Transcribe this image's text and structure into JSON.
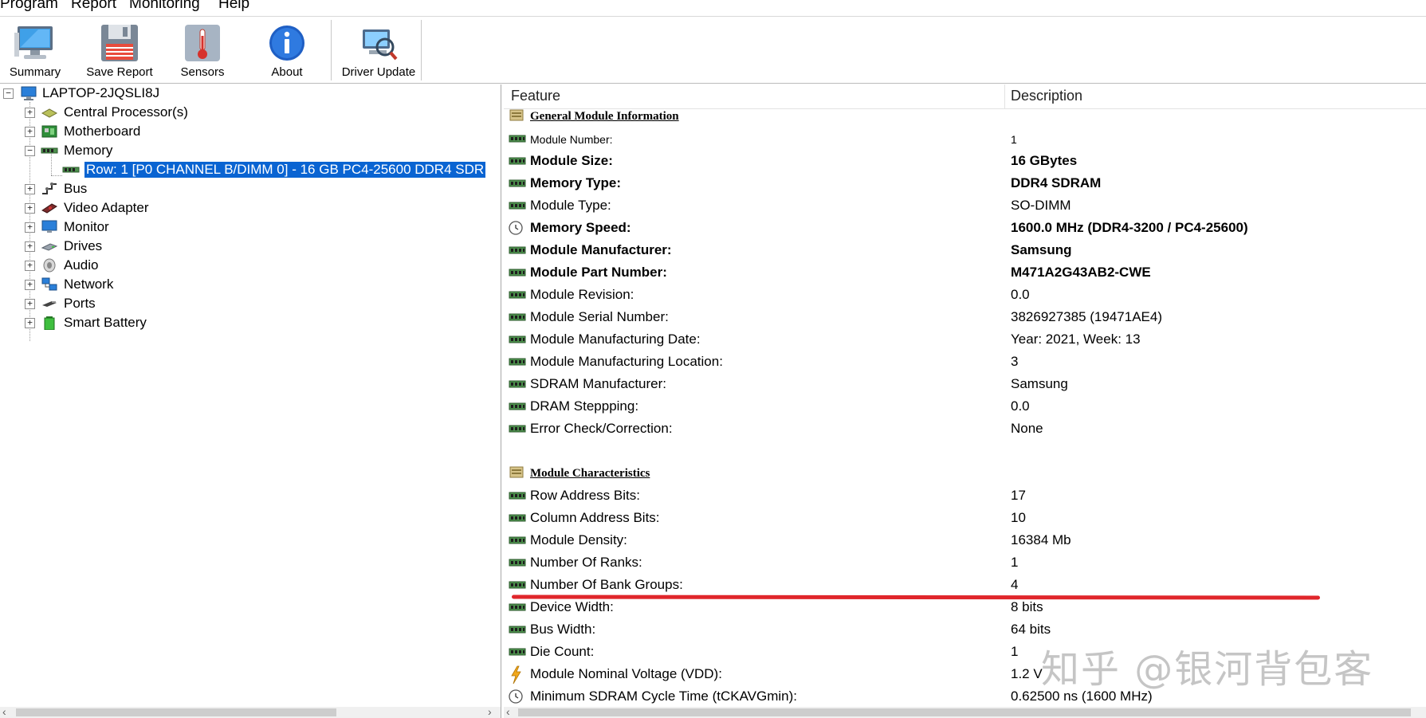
{
  "menu": [
    {
      "label": "Program"
    },
    {
      "label": "Report"
    },
    {
      "label": "Monitoring"
    },
    {
      "label": "Help"
    }
  ],
  "toolbar": {
    "summary": "Summary",
    "save_report": "Save Report",
    "sensors": "Sensors",
    "about": "About",
    "driver_update": "Driver Update"
  },
  "tree": {
    "root": "LAPTOP-2JQSLI8J",
    "items": [
      {
        "label": "Central Processor(s)",
        "icon": "cpu-icon"
      },
      {
        "label": "Motherboard",
        "icon": "motherboard-icon"
      },
      {
        "label": "Memory",
        "icon": "memory-icon"
      },
      {
        "label": "Row: 1 [P0 CHANNEL B/DIMM 0] - 16 GB PC4-25600 DDR4 SDR",
        "icon": "memory-module-icon"
      },
      {
        "label": "Bus",
        "icon": "bus-icon"
      },
      {
        "label": "Video Adapter",
        "icon": "video-adapter-icon"
      },
      {
        "label": "Monitor",
        "icon": "monitor-icon"
      },
      {
        "label": "Drives",
        "icon": "drive-icon"
      },
      {
        "label": "Audio",
        "icon": "audio-icon"
      },
      {
        "label": "Network",
        "icon": "network-icon"
      },
      {
        "label": "Ports",
        "icon": "ports-icon"
      },
      {
        "label": "Smart Battery",
        "icon": "battery-icon"
      }
    ]
  },
  "table": {
    "col_feature": "Feature",
    "col_description": "Description",
    "rows": [
      {
        "feature": "General Module Information",
        "desc": "",
        "type": "section"
      },
      {
        "feature": "Module Number:",
        "desc": "1",
        "type": "small"
      },
      {
        "feature": "Module Size:",
        "desc": "16 GBytes",
        "type": "bold"
      },
      {
        "feature": "Memory Type:",
        "desc": "DDR4 SDRAM",
        "type": "bold"
      },
      {
        "feature": "Module Type:",
        "desc": "SO-DIMM",
        "type": "normal"
      },
      {
        "feature": "Memory Speed:",
        "desc": "1600.0 MHz (DDR4-3200 / PC4-25600)",
        "type": "bold",
        "icon": "clock-icon"
      },
      {
        "feature": "Module Manufacturer:",
        "desc": "Samsung",
        "type": "bold"
      },
      {
        "feature": "Module Part Number:",
        "desc": "M471A2G43AB2-CWE",
        "type": "bold"
      },
      {
        "feature": "Module Revision:",
        "desc": "0.0",
        "type": "normal"
      },
      {
        "feature": "Module Serial Number:",
        "desc": "3826927385 (19471AE4)",
        "type": "normal"
      },
      {
        "feature": "Module Manufacturing Date:",
        "desc": "Year: 2021, Week: 13",
        "type": "normal"
      },
      {
        "feature": "Module Manufacturing Location:",
        "desc": "3",
        "type": "normal"
      },
      {
        "feature": "SDRAM Manufacturer:",
        "desc": "Samsung",
        "type": "normal"
      },
      {
        "feature": "DRAM Steppping:",
        "desc": "0.0",
        "type": "normal"
      },
      {
        "feature": "Error Check/Correction:",
        "desc": "None",
        "type": "normal"
      },
      {
        "feature": "",
        "desc": "",
        "type": "blank"
      },
      {
        "feature": "Module Characteristics",
        "desc": "",
        "type": "section"
      },
      {
        "feature": "Row Address Bits:",
        "desc": "17",
        "type": "normal"
      },
      {
        "feature": "Column Address Bits:",
        "desc": "10",
        "type": "normal"
      },
      {
        "feature": "Module Density:",
        "desc": "16384 Mb",
        "type": "normal"
      },
      {
        "feature": "Number Of Ranks:",
        "desc": "1",
        "type": "normal"
      },
      {
        "feature": "Number Of Bank Groups:",
        "desc": "4",
        "type": "normal"
      },
      {
        "feature": "Device Width:",
        "desc": "8 bits",
        "type": "normal"
      },
      {
        "feature": "Bus Width:",
        "desc": "64 bits",
        "type": "normal"
      },
      {
        "feature": "Die Count:",
        "desc": "1",
        "type": "normal"
      },
      {
        "feature": "Module Nominal Voltage (VDD):",
        "desc": "1.2 V",
        "type": "normal",
        "icon": "voltage-icon"
      },
      {
        "feature": "Minimum SDRAM Cycle Time (tCKAVGmin):",
        "desc": "0.62500 ns (1600 MHz)",
        "type": "normal",
        "icon": "clock-icon"
      }
    ]
  },
  "watermark": "知乎 @银河背包客",
  "colors": {
    "selection": "#0a64d2",
    "annotation": "#e0262b"
  }
}
